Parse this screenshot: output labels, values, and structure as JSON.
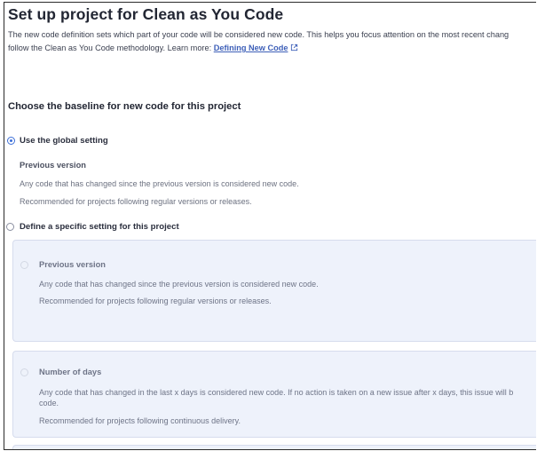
{
  "title": "Set up project for Clean as You Code",
  "description": {
    "line1": "The new code definition sets which part of your code will be considered new code. This helps you focus attention on the most recent chang",
    "line2_prefix": "follow the Clean as You Code methodology. Learn more: ",
    "link_label": "Defining New Code",
    "link_icon": "external-link-icon"
  },
  "baseline_heading": "Choose the baseline for new code for this project",
  "global_option": {
    "label": "Use the global setting",
    "selected": true,
    "detail_title": "Previous version",
    "detail_text": "Any code that has changed since the previous version is considered new code.",
    "detail_note": "Recommended for projects following regular versions or releases."
  },
  "specific_option": {
    "label": "Define a specific setting for this project",
    "selected": false
  },
  "specific_choices": [
    {
      "title": "Previous version",
      "text": "Any code that has changed since the previous version is considered new code.",
      "note": "Recommended for projects following regular versions or releases."
    },
    {
      "title": "Number of days",
      "text": "Any code that has changed in the last x days is considered new code. If no action is taken on a new issue after x days, this issue will b",
      "text_cont": "code.",
      "note": "Recommended for projects following continuous delivery."
    }
  ],
  "colors": {
    "accent": "#3d6fd8",
    "link": "#3d5fb8",
    "panel_bg": "#eef2fb"
  }
}
